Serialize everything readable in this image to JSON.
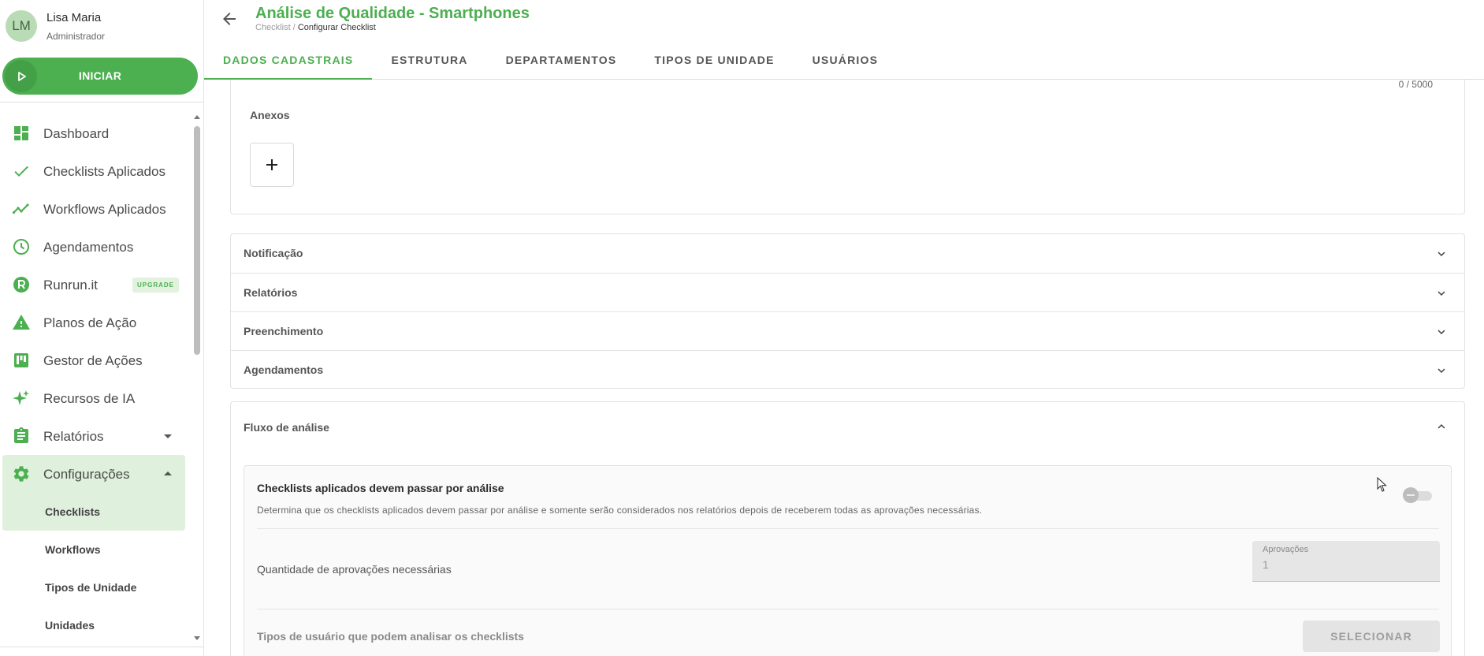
{
  "user": {
    "initials": "LM",
    "name": "Lisa Maria",
    "role": "Administrador"
  },
  "start_button": {
    "label": "INICIAR",
    "icon": "play-icon"
  },
  "sidebar": {
    "items": [
      {
        "label": "Dashboard",
        "icon": "dashboard-icon"
      },
      {
        "label": "Checklists Aplicados",
        "icon": "check-icon"
      },
      {
        "label": "Workflows Aplicados",
        "icon": "trending-icon"
      },
      {
        "label": "Agendamentos",
        "icon": "clock-icon"
      },
      {
        "label": "Runrun.it",
        "icon": "runrunit-logo-icon",
        "badge": "UPGRADE"
      },
      {
        "label": "Planos de Ação",
        "icon": "warning-icon"
      },
      {
        "label": "Gestor de Ações",
        "icon": "kanban-icon"
      },
      {
        "label": "Recursos de IA",
        "icon": "sparkle-icon"
      },
      {
        "label": "Relatórios",
        "icon": "clipboard-icon"
      },
      {
        "label": "Configurações",
        "icon": "gear-icon"
      }
    ],
    "sub_items": [
      {
        "label": "Checklists"
      },
      {
        "label": "Workflows"
      },
      {
        "label": "Tipos de Unidade"
      },
      {
        "label": "Unidades"
      }
    ]
  },
  "header": {
    "title": "Análise de Qualidade - Smartphones",
    "breadcrumb_parent": "Checklist /",
    "breadcrumb_current": "Configurar Checklist"
  },
  "tabs": [
    {
      "label": "DADOS CADASTRAIS"
    },
    {
      "label": "ESTRUTURA"
    },
    {
      "label": "DEPARTAMENTOS"
    },
    {
      "label": "TIPOS DE UNIDADE"
    },
    {
      "label": "USUÁRIOS"
    }
  ],
  "description_counter": "0 / 5000",
  "attachments": {
    "title": "Anexos",
    "add_icon": "plus-icon"
  },
  "accordions": [
    {
      "label": "Notificação"
    },
    {
      "label": "Relatórios"
    },
    {
      "label": "Preenchimento"
    },
    {
      "label": "Agendamentos"
    }
  ],
  "analysis_flow": {
    "title": "Fluxo de análise",
    "rule_title": "Checklists aplicados devem passar por análise",
    "rule_description": "Determina que os checklists aplicados devem passar por análise e somente serão considerados nos relatórios depois de receberem todas as aprovações necessárias.",
    "toggle_enabled": false,
    "approvals_label": "Quantidade de aprovações necessárias",
    "approvals_field_label": "Aprovações",
    "approvals_value": "1",
    "user_types_label": "Tipos de usuário que podem analisar os checklists",
    "select_button": "SELECIONAR"
  },
  "colors": {
    "accent": "#4caf50",
    "accent_light": "#dff0dc",
    "text": "#3d3d3d"
  }
}
